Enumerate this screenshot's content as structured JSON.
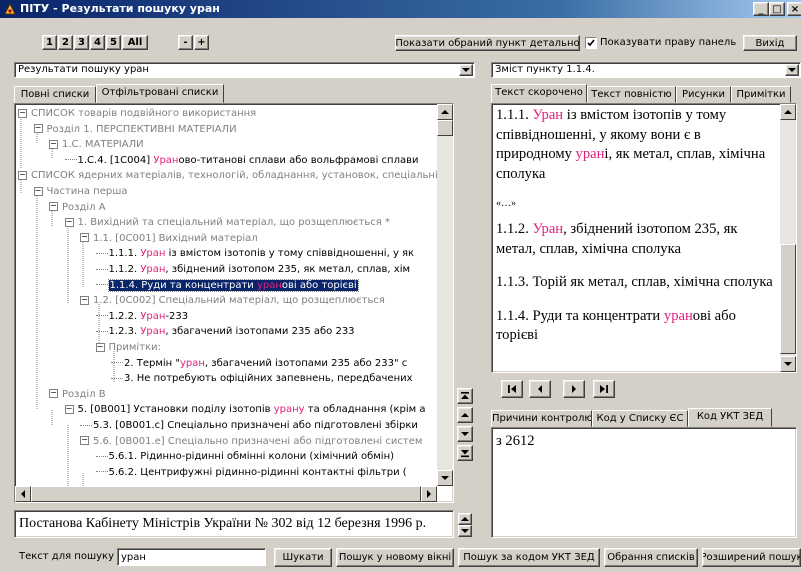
{
  "window": {
    "title": "ПІТУ - Результати пошуку уран",
    "controls": [
      "_",
      "□",
      "×"
    ]
  },
  "toolbar": {
    "levels": [
      "1",
      "2",
      "3",
      "4",
      "5",
      "All"
    ],
    "collapse": "-",
    "expand": "+",
    "show_detail_label": "Показати обраний пункт детально",
    "show_right_panel_label": "Показувати праву панель",
    "show_right_panel_checked": true,
    "exit_label": "Вихід"
  },
  "left": {
    "combo_value": "Результати пошуку уран",
    "tabs": [
      "Повні списки",
      "Отфільтровані списки"
    ],
    "active_tab": 1,
    "tree": [
      {
        "parts": [
          {
            "t": "СПИСОК товарів подвійного використання",
            "c": "gray"
          }
        ]
      },
      {
        "parts": [
          {
            "t": "Розділ 1. ПЕРСПЕКТИВНІ МАТЕРІАЛИ",
            "c": "gray"
          }
        ]
      },
      {
        "parts": [
          {
            "t": "1.С. МАТЕРІАЛИ",
            "c": "gray"
          }
        ]
      },
      {
        "parts": [
          {
            "t": "1.С.4. [1С004] ",
            "c": ""
          },
          {
            "t": "Уран",
            "c": "pink"
          },
          {
            "t": "ово-титанові сплави або вольфрамові сплави",
            "c": ""
          }
        ]
      },
      {
        "parts": [
          {
            "t": "СПИСОК ядерних матеріалів, технологій, обладнання, установок, спеціальні",
            "c": "gray"
          }
        ]
      },
      {
        "parts": [
          {
            "t": "Частина перша",
            "c": "gray"
          }
        ]
      },
      {
        "parts": [
          {
            "t": "Розділ А",
            "c": "gray"
          }
        ]
      },
      {
        "parts": [
          {
            "t": "1. Вихідний та спеціальний матеріал, що розщеплюється *",
            "c": "gray"
          }
        ]
      },
      {
        "parts": [
          {
            "t": "1.1. [0С001] Вихідний матеріал",
            "c": "gray"
          }
        ]
      },
      {
        "parts": [
          {
            "t": "1.1.1. ",
            "c": ""
          },
          {
            "t": "Уран",
            "c": "pink"
          },
          {
            "t": " із вмістом ізотопів у тому співвідношенні, у як",
            "c": ""
          }
        ]
      },
      {
        "parts": [
          {
            "t": "1.1.2. ",
            "c": ""
          },
          {
            "t": "Уран",
            "c": "pink"
          },
          {
            "t": ", збіднений ізотопом 235, як метал, сплав, хім",
            "c": ""
          }
        ]
      },
      {
        "parts": [
          {
            "t": "1.1.4. Руди та концентрати ",
            "c": ""
          },
          {
            "t": "уран",
            "c": "pink"
          },
          {
            "t": "ові або торієві",
            "c": ""
          }
        ],
        "selected": true
      },
      {
        "parts": [
          {
            "t": "1.2. [0С002] Спеціальний матеріал, що розщеплюється",
            "c": "gray"
          }
        ]
      },
      {
        "parts": [
          {
            "t": "1.2.2. ",
            "c": ""
          },
          {
            "t": "Уран",
            "c": "pink"
          },
          {
            "t": "-233",
            "c": ""
          }
        ]
      },
      {
        "parts": [
          {
            "t": "1.2.3. ",
            "c": ""
          },
          {
            "t": "Уран",
            "c": "pink"
          },
          {
            "t": ", збагачений ізотопами 235 або 233",
            "c": ""
          }
        ]
      },
      {
        "parts": [
          {
            "t": "Примітки:",
            "c": "gray"
          }
        ]
      },
      {
        "parts": [
          {
            "t": "2. Термін \"",
            "c": ""
          },
          {
            "t": "уран",
            "c": "pink"
          },
          {
            "t": ", збагачений ізотопами 235 або 233\" с",
            "c": ""
          }
        ]
      },
      {
        "parts": [
          {
            "t": "3. Не потребують офіційних запевнень, передбачених",
            "c": ""
          }
        ]
      },
      {
        "parts": [
          {
            "t": "Розділ В",
            "c": "gray"
          }
        ]
      },
      {
        "parts": [
          {
            "t": "5. [0В001] Установки поділу ізотопів ",
            "c": ""
          },
          {
            "t": "урану",
            "c": "pink"
          },
          {
            "t": " та обладнання (крім а",
            "c": ""
          }
        ]
      },
      {
        "parts": [
          {
            "t": "5.3. [0В001.с] Спеціально призначені або підготовлені збірки",
            "c": ""
          }
        ]
      },
      {
        "parts": [
          {
            "t": "5.6. [0В001.е] Спеціально призначені або підготовлені систем",
            "c": "gray"
          }
        ]
      },
      {
        "parts": [
          {
            "t": "5.6.1. Рідинно-рідинні обмінні колони (хімічний обмін)",
            "c": ""
          }
        ]
      },
      {
        "parts": [
          {
            "t": "5.6.2. Центрифужні рідинно-рідинні контактні фільтри (",
            "c": ""
          }
        ]
      }
    ],
    "footer_text": "Постанова Кабінету Міністрів України № 302 від 12 березня 1996 р."
  },
  "right": {
    "combo_value": "Зміст пункту 1.1.4.",
    "tabs": [
      "Текст скорочено",
      "Текст повністю",
      "Рисунки",
      "Примітки"
    ],
    "active_tab": 0,
    "content": [
      {
        "parts": [
          {
            "t": "1.1.1. ",
            "c": ""
          },
          {
            "t": "Уран",
            "c": "pink"
          },
          {
            "t": " із вмістом ізотопів у тому співвідношенні, у якому вони є в природному ",
            "c": ""
          },
          {
            "t": "уран",
            "c": "pink"
          },
          {
            "t": "і, як метал, сплав, хімічна сполука",
            "c": ""
          }
        ]
      },
      {
        "parts": [
          {
            "t": "«…»",
            "c": ""
          }
        ],
        "small": true
      },
      {
        "parts": [
          {
            "t": "1.1.2. ",
            "c": ""
          },
          {
            "t": "Уран",
            "c": "pink"
          },
          {
            "t": ", збіднений ізотопом 235, як метал, сплав, хімічна сполука",
            "c": ""
          }
        ]
      },
      {
        "parts": [
          {
            "t": "1.1.3. Торій як метал, сплав, хімічна сполука",
            "c": ""
          }
        ]
      },
      {
        "parts": [
          {
            "t": "1.1.4. Руди та концентрати ",
            "c": ""
          },
          {
            "t": "уран",
            "c": "pink"
          },
          {
            "t": "ові або торієві",
            "c": ""
          }
        ]
      }
    ],
    "nav": [
      "first",
      "prev",
      "next",
      "last"
    ],
    "bottom_tabs": [
      "Причини контролю",
      "Код у Списку ЄС",
      "Код УКТ ЗЕД"
    ],
    "bottom_active_tab": 2,
    "code_value": "з 2612"
  },
  "search": {
    "label": "Текст для пошуку",
    "value": "уран",
    "buttons": [
      "Шукати",
      "Пошук у новому вікні",
      "Пошук за кодом УКТ ЗЕД",
      "Обрання списків",
      "Розширений пошук"
    ]
  },
  "colors": {
    "highlight": "#e0207f",
    "selection": "#0a246a",
    "title_bar": "#0a246a"
  }
}
